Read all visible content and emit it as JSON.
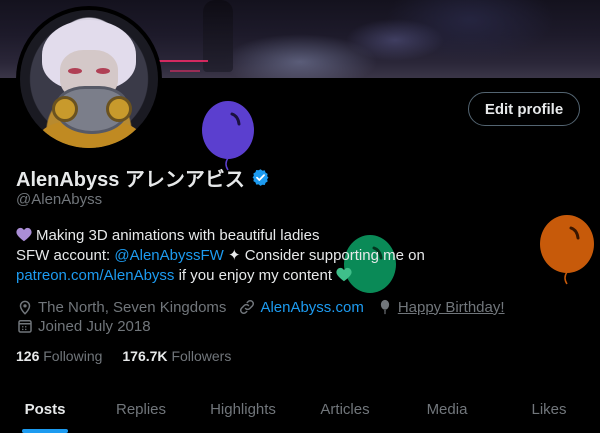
{
  "header": {
    "edit_profile_label": "Edit profile"
  },
  "profile": {
    "display_name": "AlenAbyss アレンアビス",
    "handle": "@AlenAbyss",
    "bio_line1": "Making 3D animations with beautiful ladies",
    "bio_line2_prefix": "SFW account: ",
    "bio_line2_link": "@AlenAbyssFW",
    "bio_line2_suffix": " ✦ Consider supporting me on",
    "bio_line3_link": "patreon.com/AlenAbyss",
    "bio_line3_suffix": " if you enjoy my content ",
    "location": "The North, Seven Kingdoms",
    "website": "AlenAbyss.com",
    "birthday": "Happy Birthday!",
    "joined": "Joined July 2018",
    "following_count": "126",
    "following_label": "Following",
    "followers_count": "176.7K",
    "followers_label": "Followers"
  },
  "tabs": [
    {
      "label": "Posts",
      "active": true
    },
    {
      "label": "Replies"
    },
    {
      "label": "Highlights"
    },
    {
      "label": "Articles"
    },
    {
      "label": "Media"
    },
    {
      "label": "Likes"
    }
  ],
  "colors": {
    "accent": "#1d9bf0",
    "balloon_purple": "#5b3fcf",
    "balloon_green": "#0a8a57",
    "balloon_orange": "#c75a0a"
  },
  "icons": [
    "verified-badge-icon",
    "purple-heart-icon",
    "location-icon",
    "link-icon",
    "balloon-icon",
    "calendar-icon",
    "green-heart-icon"
  ]
}
